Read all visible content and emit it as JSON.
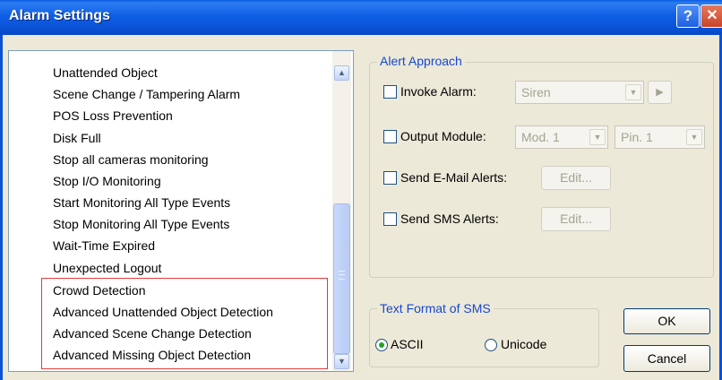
{
  "window": {
    "title": "Alarm Settings",
    "help_glyph": "?",
    "close_glyph": "✕"
  },
  "event_list": {
    "items": [
      "Unattended Object",
      "Scene Change / Tampering Alarm",
      "POS Loss Prevention",
      "Disk Full",
      "Stop all cameras monitoring",
      "Stop I/O Monitoring",
      "Start Monitoring All Type Events",
      "Stop Monitoring All Type Events",
      "Wait-Time Expired",
      "Unexpected Logout",
      "Crowd Detection",
      "Advanced Unattended Object Detection",
      "Advanced Scene Change Detection",
      "Advanced Missing Object Detection"
    ],
    "highlighted_items": [
      "Crowd Detection",
      "Advanced Unattended Object Detection",
      "Advanced Scene Change Detection",
      "Advanced Missing Object Detection"
    ],
    "highlight_color": "#e23a3a",
    "scroll_up_glyph": "▲",
    "scroll_down_glyph": "▼"
  },
  "alert_approach": {
    "group_label": "Alert Approach",
    "invoke_alarm": {
      "label": "Invoke Alarm:",
      "checked": false,
      "value": "Siren",
      "play_glyph": "▶"
    },
    "output_module": {
      "label": "Output Module:",
      "checked": false,
      "module_value": "Mod. 1",
      "pin_value": "Pin. 1"
    },
    "email": {
      "label": "Send E-Mail Alerts:",
      "checked": false,
      "edit_label": "Edit..."
    },
    "sms": {
      "label": "Send SMS Alerts:",
      "checked": false,
      "edit_label": "Edit..."
    }
  },
  "sms_format": {
    "group_label": "Text Format of SMS",
    "options": [
      "ASCII",
      "Unicode"
    ],
    "selected": "ASCII"
  },
  "actions": {
    "ok_label": "OK",
    "cancel_label": "Cancel"
  },
  "combo_arrow_glyph": "▼",
  "colors": {
    "title_bar": "#0a52d6",
    "group_label": "#1747cf",
    "radio_selected": "#21a121"
  }
}
